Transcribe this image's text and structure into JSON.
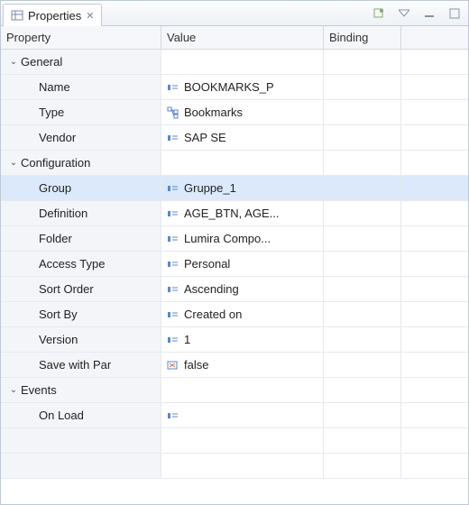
{
  "tab": {
    "title": "Properties",
    "close_tooltip": "Close"
  },
  "toolbar": {
    "pin": "pin",
    "menu": "view-menu",
    "minimize": "minimize",
    "maximize": "maximize"
  },
  "columns": {
    "property": "Property",
    "value": "Value",
    "binding": "Binding"
  },
  "groups": [
    {
      "name": "General",
      "expanded": true,
      "rows": [
        {
          "label": "Name",
          "value": "BOOKMARKS_P",
          "icon": "text"
        },
        {
          "label": "Type",
          "value": "Bookmarks",
          "icon": "tree"
        },
        {
          "label": "Vendor",
          "value": "SAP SE",
          "icon": "text"
        }
      ]
    },
    {
      "name": "Configuration",
      "expanded": true,
      "rows": [
        {
          "label": "Group",
          "value": "Gruppe_1",
          "icon": "text",
          "selected": true
        },
        {
          "label": "Definition",
          "value": "AGE_BTN, AGE...",
          "icon": "text"
        },
        {
          "label": "Folder",
          "value": "Lumira Compo...",
          "icon": "text"
        },
        {
          "label": "Access Type",
          "value": "Personal",
          "icon": "text"
        },
        {
          "label": "Sort Order",
          "value": "Ascending",
          "icon": "text"
        },
        {
          "label": "Sort By",
          "value": "Created on",
          "icon": "text"
        },
        {
          "label": "Version",
          "value": "1",
          "icon": "text"
        },
        {
          "label": "Save with Par",
          "value": "false",
          "icon": "bool"
        }
      ]
    },
    {
      "name": "Events",
      "expanded": true,
      "rows": [
        {
          "label": "On Load",
          "value": "",
          "icon": "text"
        }
      ]
    }
  ]
}
